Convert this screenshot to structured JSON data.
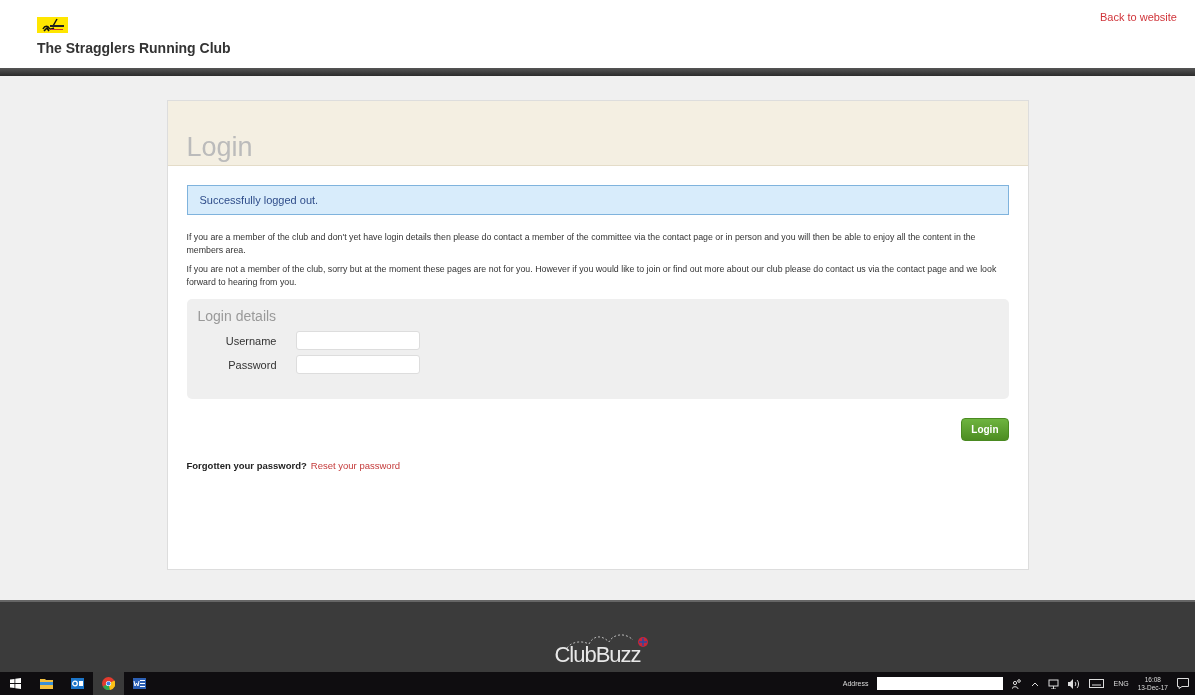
{
  "header": {
    "club_name": "The Stragglers Running Club",
    "back_link": "Back to website"
  },
  "card": {
    "title": "Login",
    "alert": "Successfully logged out.",
    "paragraphs": [
      "If you are a member of the club and don't yet have login details then please do contact a member of the committee via the contact page or in person and you will then be able to enjoy all the content in the members area.",
      "If you are not a member of the club, sorry but at the moment these pages are not for you. However if you would like to join or find out more about our club please do contact us via the contact page and we look forward to hearing from you."
    ],
    "fieldset": {
      "legend": "Login details",
      "fields": [
        {
          "label": "Username"
        },
        {
          "label": "Password"
        }
      ]
    },
    "submit": "Login",
    "forgot": {
      "prompt": "Forgotten your password?",
      "link": "Reset your password"
    }
  },
  "footer": {
    "brand": "ClubBuzz"
  },
  "taskbar": {
    "apps": [
      {
        "kind": "start",
        "selected": false
      },
      {
        "kind": "folder",
        "selected": false
      },
      {
        "kind": "mail",
        "selected": false
      },
      {
        "kind": "browser",
        "selected": true
      },
      {
        "kind": "document",
        "selected": false
      }
    ],
    "address_label": "Address",
    "language": "ENG",
    "time": "16:08",
    "date": "13-Dec-17"
  }
}
